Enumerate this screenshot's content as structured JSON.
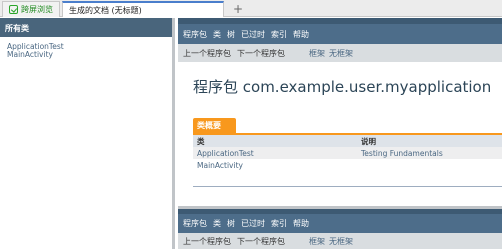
{
  "tabs": [
    {
      "label": "跨屏浏览"
    },
    {
      "label": "生成的文档 (无标题)"
    }
  ],
  "new_tab": "+",
  "left_frame": {
    "header": "所有类",
    "classes": [
      "ApplicationTest",
      "MainActivity"
    ]
  },
  "navbar": {
    "items": [
      "程序包",
      "类",
      "树",
      "已过时",
      "索引",
      "帮助"
    ]
  },
  "subnav": {
    "prev": "上一个程序包",
    "next": "下一个程序包",
    "frames": "框架",
    "noframes": "无框架"
  },
  "page_title": "程序包 com.example.user.myapplication",
  "class_summary": {
    "caption": "类概要",
    "headers": [
      "类",
      "说明"
    ],
    "rows": [
      {
        "name": "ApplicationTest",
        "description": "Testing Fundamentals"
      },
      {
        "name": "MainActivity",
        "description": ""
      }
    ]
  },
  "colors": {
    "nav_blue": "#4d6d8a",
    "caption_orange": "#f8981d",
    "link_blue": "#4a6782",
    "tab_green": "#2aa52a"
  }
}
